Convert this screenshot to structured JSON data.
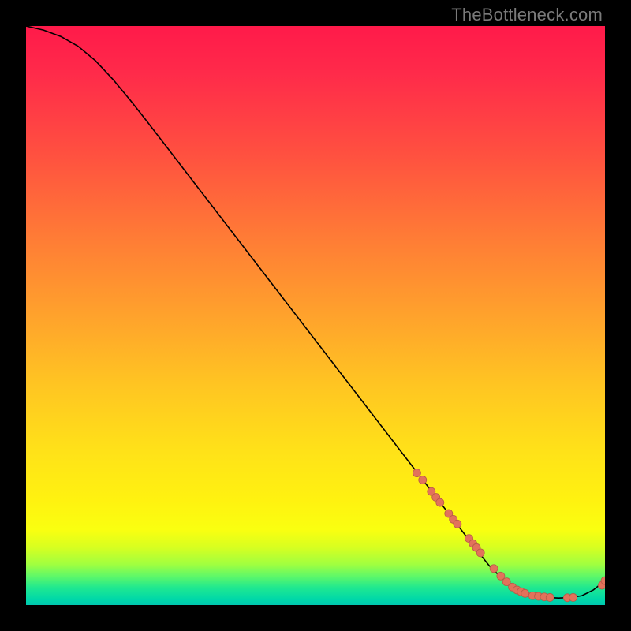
{
  "watermark": "TheBottleneck.com",
  "colors": {
    "background": "#000000",
    "curve": "#000000",
    "marker_fill": "#e2725b",
    "marker_stroke": "#b85a48"
  },
  "chart_data": {
    "type": "line",
    "title": "",
    "xlabel": "",
    "ylabel": "",
    "xlim": [
      0,
      100
    ],
    "ylim": [
      0,
      100
    ],
    "grid": false,
    "legend": false,
    "x": [
      0,
      3,
      6,
      9,
      12,
      15,
      18,
      21,
      24,
      27,
      30,
      33,
      36,
      39,
      42,
      45,
      48,
      51,
      54,
      57,
      60,
      63,
      66,
      69,
      72,
      75,
      78,
      80,
      82,
      84,
      86,
      88,
      90,
      92,
      94,
      96,
      98,
      100
    ],
    "values": [
      100,
      99.3,
      98.2,
      96.5,
      94.0,
      90.8,
      87.2,
      83.4,
      79.5,
      75.6,
      71.7,
      67.8,
      63.9,
      60.0,
      56.1,
      52.2,
      48.3,
      44.4,
      40.5,
      36.6,
      32.7,
      28.8,
      24.9,
      21.0,
      17.1,
      13.2,
      9.3,
      6.8,
      4.8,
      3.2,
      2.2,
      1.6,
      1.3,
      1.2,
      1.3,
      1.6,
      2.6,
      4.2
    ],
    "markers": {
      "x": [
        67.5,
        68.5,
        70.0,
        70.8,
        71.5,
        73.0,
        73.8,
        74.5,
        76.5,
        77.2,
        77.8,
        78.5,
        80.8,
        82.0,
        83.0,
        84.0,
        84.8,
        85.5,
        86.2,
        87.5,
        88.5,
        89.5,
        90.5,
        93.5,
        94.5,
        99.5,
        100.0
      ],
      "values": [
        22.8,
        21.6,
        19.6,
        18.6,
        17.7,
        15.8,
        14.8,
        14.0,
        11.5,
        10.6,
        9.9,
        9.0,
        6.3,
        5.0,
        4.0,
        3.1,
        2.6,
        2.3,
        2.0,
        1.6,
        1.5,
        1.4,
        1.3,
        1.25,
        1.3,
        3.4,
        4.2
      ]
    }
  }
}
